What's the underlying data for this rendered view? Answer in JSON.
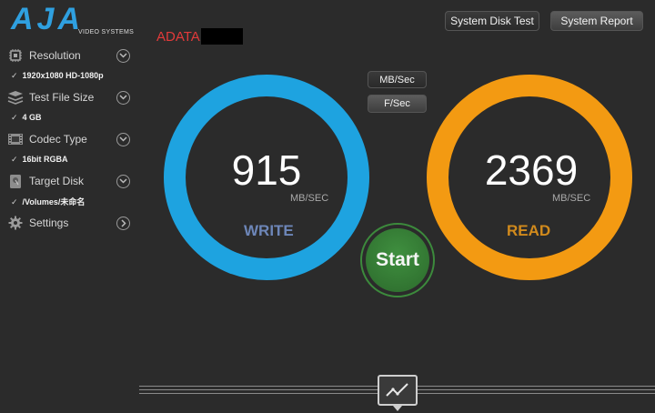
{
  "logo": {
    "name": "AJA",
    "tagline": "VIDEO SYSTEMS"
  },
  "sidebar": {
    "items": [
      {
        "label": "Resolution",
        "value": "1920x1080 HD-1080p",
        "icon": "resolution-chip-icon"
      },
      {
        "label": "Test File Size",
        "value": "4 GB",
        "icon": "stack-icon"
      },
      {
        "label": "Codec Type",
        "value": "16bit RGBA",
        "icon": "film-strip-icon"
      },
      {
        "label": "Target Disk",
        "value": "/Volumes/未命名",
        "icon": "hard-disk-icon"
      },
      {
        "label": "Settings",
        "icon": "gear-icon"
      }
    ],
    "check_mark": "✓"
  },
  "toolbar": {
    "system_disk_test": "System Disk Test",
    "system_report": "System Report"
  },
  "drive_name": "ADATA",
  "units": {
    "mbsec": "MB/Sec",
    "fsec": "F/Sec"
  },
  "write": {
    "value": "915",
    "unit": "MB/SEC",
    "label": "WRITE",
    "color": "#1ea3e0"
  },
  "read": {
    "value": "2369",
    "unit": "MB/SEC",
    "label": "READ",
    "color": "#f39a12"
  },
  "start_label": "Start",
  "colors": {
    "write_label": "#6d86b8",
    "read_label": "#d18a1c",
    "start_green": "#3a8a3a"
  }
}
